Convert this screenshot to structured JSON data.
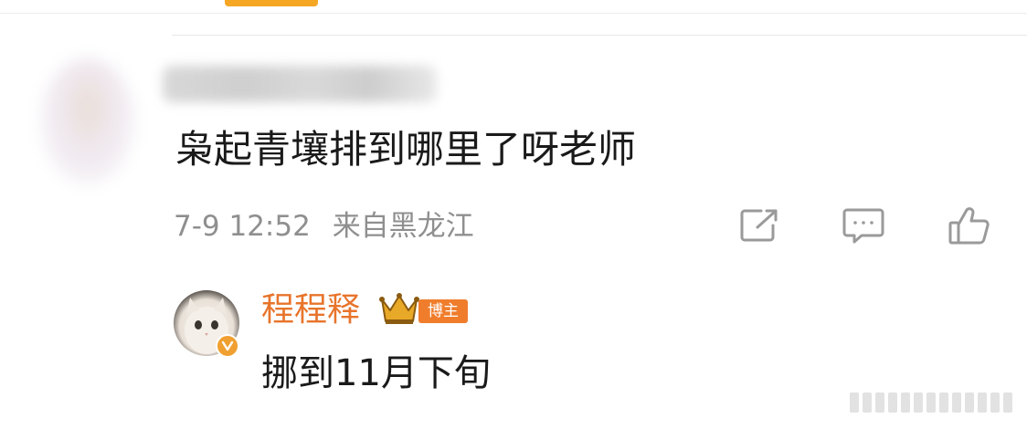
{
  "comment": {
    "text": "枭起青壤排到哪里了呀老师",
    "date": "7-9 12:52",
    "location": "来自黑龙江",
    "actions": [
      "share-icon",
      "comment-icon",
      "like-icon"
    ]
  },
  "reply": {
    "author": "程程释",
    "badge": "博主",
    "text": "挪到11月下旬"
  },
  "colors": {
    "accent_orange": "#e8742b",
    "badge_orange": "#f07d2c",
    "meta_gray": "#8f8f8f",
    "icon_gray": "#9a9a9a"
  }
}
